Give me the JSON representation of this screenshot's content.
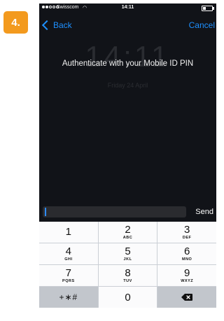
{
  "step": {
    "label": "4."
  },
  "status_bar": {
    "carrier": "Swisscom",
    "time": "14:11"
  },
  "nav": {
    "back_label": "Back",
    "cancel_label": "Cancel"
  },
  "lock_screen": {
    "clock": "14:11",
    "date": "Friday 24 April"
  },
  "prompt": {
    "text": "Authenticate with your Mobile ID PIN"
  },
  "input": {
    "value": "",
    "send_label": "Send"
  },
  "keypad": {
    "keys": [
      {
        "digit": "1",
        "letters": ""
      },
      {
        "digit": "2",
        "letters": "ABC"
      },
      {
        "digit": "3",
        "letters": "DEF"
      },
      {
        "digit": "4",
        "letters": "GHI"
      },
      {
        "digit": "5",
        "letters": "JKL"
      },
      {
        "digit": "6",
        "letters": "MNO"
      },
      {
        "digit": "7",
        "letters": "PQRS"
      },
      {
        "digit": "8",
        "letters": "TUV"
      },
      {
        "digit": "9",
        "letters": "WXYZ"
      }
    ],
    "symbols_label": "+∗#",
    "zero": "0"
  },
  "colors": {
    "accent": "#1e90ff",
    "badge": "#f39a1e",
    "background": "#111318"
  }
}
